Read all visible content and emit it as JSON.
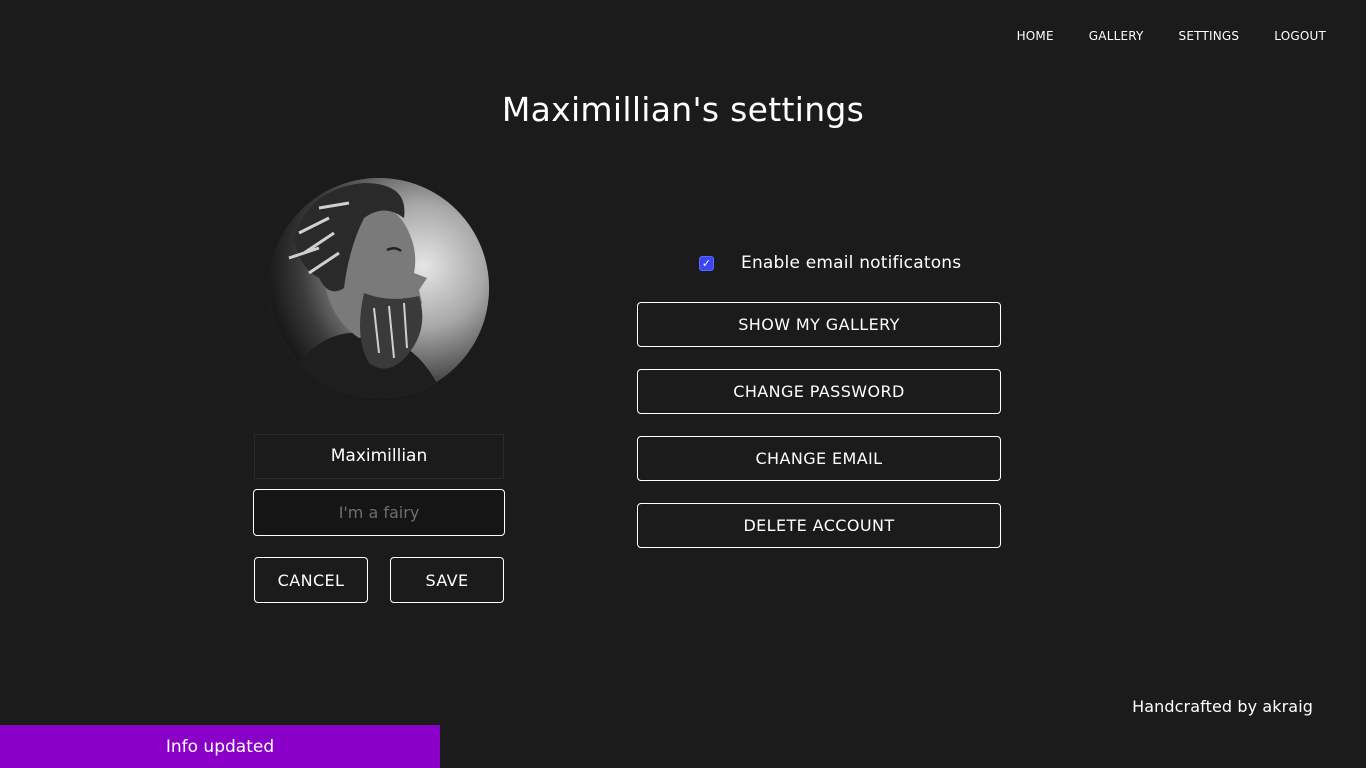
{
  "nav": {
    "items": [
      {
        "label": "HOME"
      },
      {
        "label": "GALLERY"
      },
      {
        "label": "SETTINGS"
      },
      {
        "label": "LOGOUT"
      }
    ]
  },
  "page": {
    "title": "Maximillian's settings"
  },
  "profile": {
    "name": "Maximillian",
    "bio_placeholder": "I'm a fairy",
    "bio_value": ""
  },
  "form_actions": {
    "cancel_label": "CANCEL",
    "save_label": "SAVE"
  },
  "settings": {
    "email_notifications_label": "Enable email notificatons",
    "email_notifications_checked": true,
    "show_gallery_label": "SHOW MY GALLERY",
    "change_password_label": "CHANGE PASSWORD",
    "change_email_label": "CHANGE EMAIL",
    "delete_account_label": "DELETE ACCOUNT"
  },
  "footer": {
    "credit": "Handcrafted by akraig"
  },
  "toast": {
    "message": "Info updated"
  },
  "colors": {
    "background": "#1b1b1b",
    "toast": "#8a00c9",
    "checkbox": "#3b46f1"
  },
  "icons": {
    "checkbox": "check-icon"
  }
}
